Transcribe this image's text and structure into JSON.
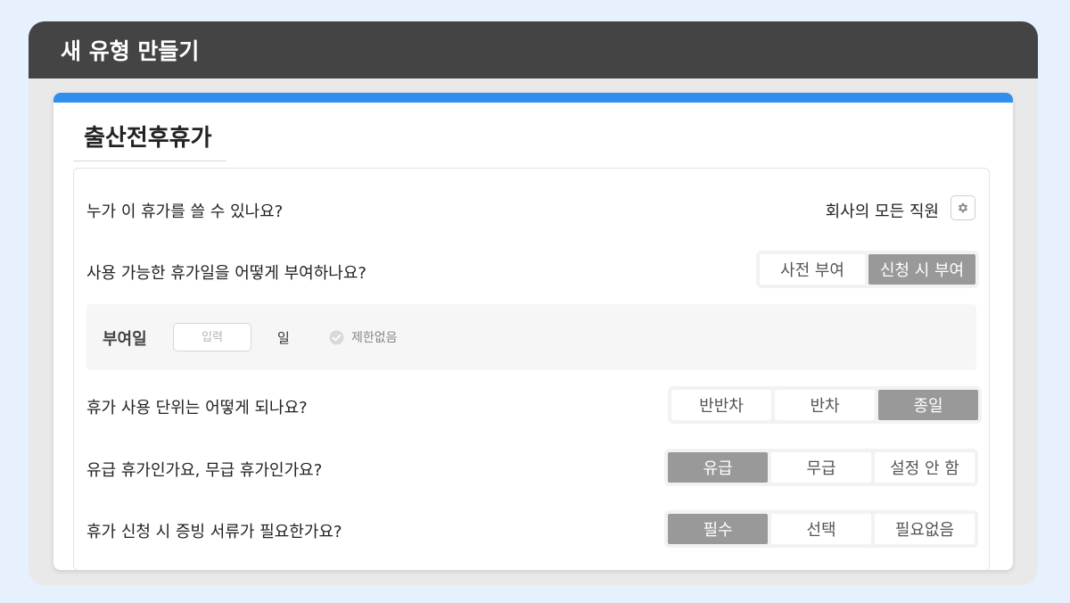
{
  "window": {
    "title": "새 유형 만들기"
  },
  "card": {
    "title": "출산전후휴가"
  },
  "who": {
    "question": "누가 이 휴가를 쓸 수 있나요?",
    "value": "회사의 모든 직원",
    "icon": "gear-icon"
  },
  "grant_method": {
    "question": "사용 가능한 휴가일을 어떻게 부여하나요?",
    "options": [
      "사전 부여",
      "신청 시 부여"
    ],
    "selected": "신청 시 부여"
  },
  "grant_days": {
    "label": "부여일",
    "placeholder": "입력",
    "value": "",
    "unit": "일",
    "nolimit_label": "제한없음",
    "nolimit_checked": false
  },
  "unit": {
    "question": "휴가 사용 단위는 어떻게 되나요?",
    "options": [
      "반반차",
      "반차",
      "종일"
    ],
    "selected": "종일"
  },
  "paid": {
    "question": "유급 휴가인가요, 무급 휴가인가요?",
    "options": [
      "유급",
      "무급",
      "설정 안 함"
    ],
    "selected": "유급"
  },
  "proof": {
    "question": "휴가 신청 시 증빙 서류가 필요한가요?",
    "options": [
      "필수",
      "선택",
      "필요없음"
    ],
    "selected": "필수"
  },
  "colors": {
    "page_bg": "#e6f1fd",
    "titlebar_bg": "#444444",
    "accent": "#2f8fef",
    "selected_option": "#999999"
  }
}
